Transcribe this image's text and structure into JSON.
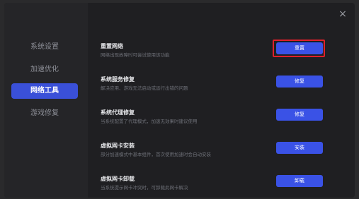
{
  "close_label": "×",
  "sidebar": {
    "items": [
      {
        "label": "系统设置",
        "active": false
      },
      {
        "label": "加速优化",
        "active": false
      },
      {
        "label": "网络工具",
        "active": true
      },
      {
        "label": "游戏修复",
        "active": false
      }
    ]
  },
  "tools": [
    {
      "title": "重置网络",
      "desc": "网络出现故障时可尝试使用该功能",
      "button": "重置",
      "highlighted": true
    },
    {
      "title": "系统服务修复",
      "desc": "解决应用、游戏无法启动或运行出错的问题",
      "button": "修复",
      "highlighted": false
    },
    {
      "title": "系统代理修复",
      "desc": "当系统配置了代理模式，加速无效果时建议使用",
      "button": "修复",
      "highlighted": false
    },
    {
      "title": "虚拟网卡安装",
      "desc": "部分加速模式中基本组件，首次使用加速时会自动安装",
      "button": "安装",
      "highlighted": false
    },
    {
      "title": "虚拟网卡卸载",
      "desc": "当系统提示网卡冲突时，可卸载此网卡解决",
      "button": "卸载",
      "highlighted": false
    }
  ],
  "colors": {
    "accent": "#3a52e6",
    "highlight_border": "#e0202a",
    "background": "#1f1f22"
  }
}
